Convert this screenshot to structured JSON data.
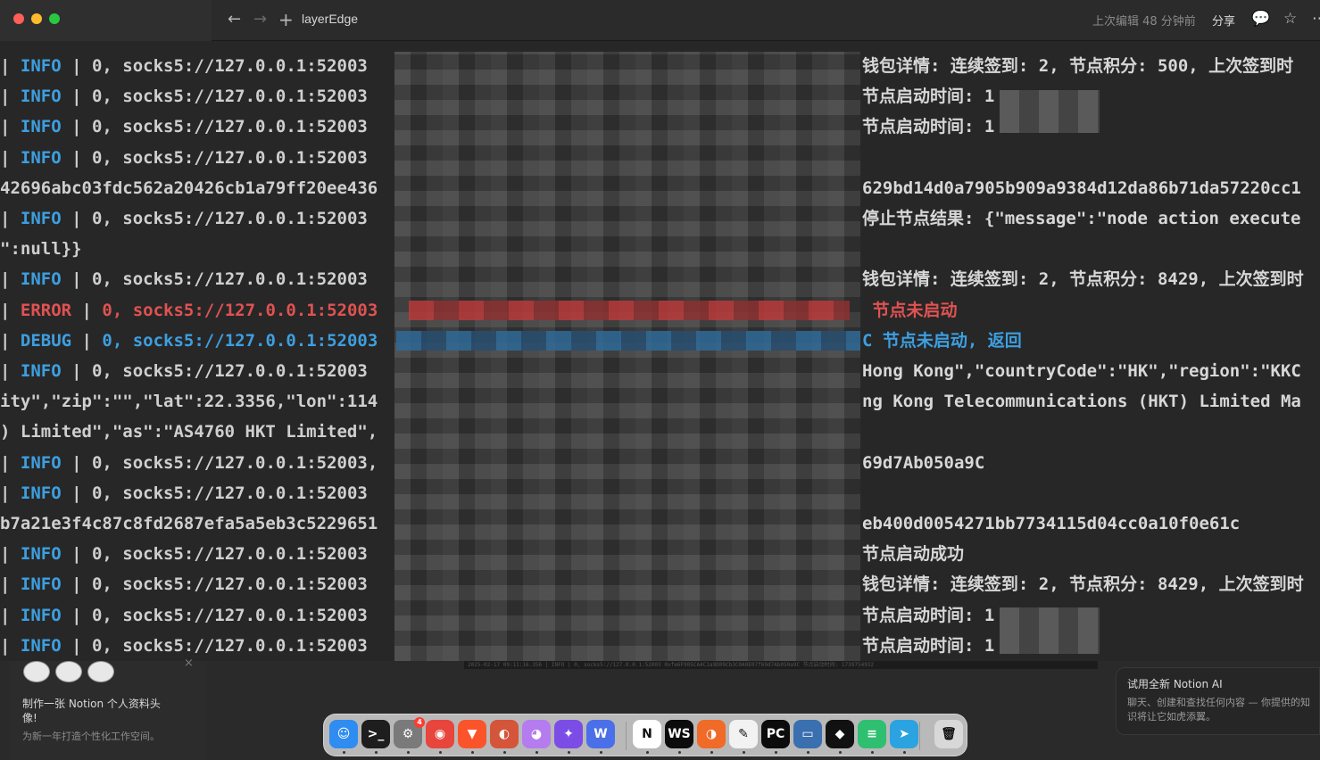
{
  "window": {
    "nav_back": "←",
    "nav_forward": "→",
    "nav_add": "+",
    "title": "layerEdge",
    "last_edited": "上次编辑 48 分钟前",
    "share": "分享",
    "comment_icon": "💬",
    "star_icon": "☆",
    "more_icon": "⋯"
  },
  "terminal": {
    "lines": [
      {
        "bar1": "| ",
        "level": "INFO",
        "bar2": " | ",
        "msg": "0, socks5://127.0.0.1:52003",
        "right": "钱包详情: 连续签到: 2, 节点积分: 500, 上次签到时"
      },
      {
        "bar1": "| ",
        "level": "INFO",
        "bar2": " | ",
        "msg": "0, socks5://127.0.0.1:52003",
        "right": "节点启动时间: 1"
      },
      {
        "bar1": "| ",
        "level": "INFO",
        "bar2": " | ",
        "msg": "0, socks5://127.0.0.1:52003",
        "right": "节点启动时间: 1"
      },
      {
        "bar1": "| ",
        "level": "INFO",
        "bar2": " | ",
        "msg": "0, socks5://127.0.0.1:52003",
        "right": ""
      },
      {
        "bar1": "",
        "level": "",
        "bar2": "",
        "msg": "42696abc03fdc562a20426cb1a79ff20ee436",
        "right": "629bd14d0a7905b909a9384d12da86b71da57220cc1"
      },
      {
        "bar1": "| ",
        "level": "INFO",
        "bar2": " | ",
        "msg": "0, socks5://127.0.0.1:52003",
        "right": "停止节点结果: {\"message\":\"node action execute"
      },
      {
        "bar1": "",
        "level": "",
        "bar2": "",
        "msg": "\":null}}",
        "right": ""
      },
      {
        "bar1": "| ",
        "level": "INFO",
        "bar2": " | ",
        "msg": "0, socks5://127.0.0.1:52003",
        "right": "钱包详情: 连续签到: 2, 节点积分: 8429, 上次签到时"
      },
      {
        "bar1": "| ",
        "level": "ERROR",
        "bar2": " | ",
        "msg": "0, socks5://127.0.0.1:52003",
        "right": " 节点未启动"
      },
      {
        "bar1": "| ",
        "level": "DEBUG",
        "bar2": " | ",
        "msg": "0, socks5://127.0.0.1:52003",
        "right": "C 节点未启动, 返回"
      },
      {
        "bar1": "| ",
        "level": "INFO",
        "bar2": " | ",
        "msg": "0, socks5://127.0.0.1:52003",
        "right": "Hong Kong\",\"countryCode\":\"HK\",\"region\":\"KKC"
      },
      {
        "bar1": "",
        "level": "",
        "bar2": "",
        "msg": "ity\",\"zip\":\"\",\"lat\":22.3356,\"lon\":114",
        "right": "ng Kong Telecommunications (HKT) Limited Ma"
      },
      {
        "bar1": "",
        "level": "",
        "bar2": "",
        "msg": ") Limited\",\"as\":\"AS4760 HKT Limited\",",
        "right": ""
      },
      {
        "bar1": "| ",
        "level": "INFO",
        "bar2": " | ",
        "msg": "0, socks5://127.0.0.1:52003,",
        "right": "69d7Ab050a9C"
      },
      {
        "bar1": "| ",
        "level": "INFO",
        "bar2": " | ",
        "msg": "0, socks5://127.0.0.1:52003",
        "right": ""
      },
      {
        "bar1": "",
        "level": "",
        "bar2": "",
        "msg": "b7a21e3f4c87c8fd2687efa5a5eb3c5229651",
        "right": "eb400d0054271bb7734115d04cc0a10f0e61c"
      },
      {
        "bar1": "| ",
        "level": "INFO",
        "bar2": " | ",
        "msg": "0, socks5://127.0.0.1:52003",
        "right": "节点启动成功"
      },
      {
        "bar1": "| ",
        "level": "INFO",
        "bar2": " | ",
        "msg": "0, socks5://127.0.0.1:52003",
        "right": "钱包详情: 连续签到: 2, 节点积分: 8429, 上次签到时"
      },
      {
        "bar1": "| ",
        "level": "INFO",
        "bar2": " | ",
        "msg": "0, socks5://127.0.0.1:52003",
        "right": "节点启动时间: 1"
      },
      {
        "bar1": "| ",
        "level": "INFO",
        "bar2": " | ",
        "msg": "0, socks5://127.0.0.1:52003",
        "right": "节点启动时间: 1"
      }
    ]
  },
  "notion_card": {
    "close": "×",
    "title": "制作一张 Notion 个人资料头像!",
    "desc": "为新一年打造个性化工作空间。"
  },
  "status_strip": "2025-02-17 09:11:16.356 | INFO | 0, socks5://127.0.0.1:52003 0xfe6F905CA4C1a9D09Cb3C0A0E07f69d7Ab050a9C 节点启动时间: 1739754932",
  "ai_toast": {
    "title": "试用全新 Notion AI",
    "desc": "聊天、创建和查找任何内容 — 你提供的知识将让它如虎添翼。"
  },
  "dock": {
    "apps": [
      {
        "name": "finder",
        "label": "☺",
        "color": "#2f8cf0"
      },
      {
        "name": "terminal",
        "label": ">_",
        "color": "#1e1e1e"
      },
      {
        "name": "system-settings",
        "label": "⚙",
        "color": "#7a7a7a",
        "badge": "4"
      },
      {
        "name": "chrome",
        "label": "◉",
        "color": "#e8453c"
      },
      {
        "name": "brave",
        "label": "▼",
        "color": "#fb542b"
      },
      {
        "name": "app-6",
        "label": "◐",
        "color": "#d4553a"
      },
      {
        "name": "app-7",
        "label": "◕",
        "color": "#b57cf0"
      },
      {
        "name": "app-8",
        "label": "✦",
        "color": "#7b4de6"
      },
      {
        "name": "app-9",
        "label": "W",
        "color": "#4a6fe8"
      },
      {
        "name": "notion",
        "label": "N",
        "color": "#ffffff"
      },
      {
        "name": "webstorm",
        "label": "WS",
        "color": "#0c0c0c"
      },
      {
        "name": "app-12",
        "label": "◑",
        "color": "#f06a28"
      },
      {
        "name": "app-13",
        "label": "✎",
        "color": "#f2f2f2"
      },
      {
        "name": "pycharm",
        "label": "PC",
        "color": "#0c0c0c"
      },
      {
        "name": "app-15",
        "label": "▭",
        "color": "#3a6fb0"
      },
      {
        "name": "app-16",
        "label": "◆",
        "color": "#111111"
      },
      {
        "name": "app-17",
        "label": "≡",
        "color": "#2fbf71"
      },
      {
        "name": "telegram",
        "label": "➤",
        "color": "#2aa3e0"
      },
      {
        "name": "trash",
        "label": "🗑",
        "color": "#d8d8d8"
      }
    ]
  }
}
